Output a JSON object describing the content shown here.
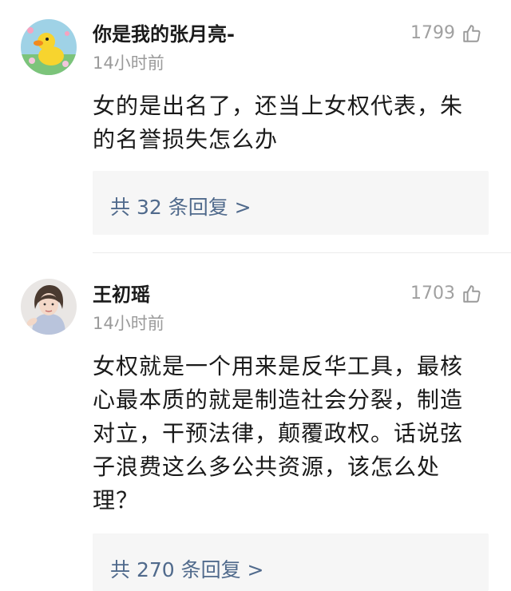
{
  "comments": [
    {
      "username": "你是我的张月亮-",
      "time": "14小时前",
      "likes": "1799",
      "avatar_icon": "duck-avatar",
      "text_lines": [
        "女的是出名了，还当上女权代表，朱",
        "的名誉损失怎么办"
      ],
      "reply_label": "共 32 条回复 >"
    },
    {
      "username": "王初瑶",
      "time": "14小时前",
      "likes": "1703",
      "avatar_icon": "woman-portrait-avatar",
      "text_lines": [
        "女权就是一个用来是反华工具，最核",
        "心最本质的就是制造社会分裂，制造",
        "对立，干预法律，颠覆政权。话说弦",
        "子浪费这么多公共资源，该怎么处",
        "理？"
      ],
      "reply_label": "共 270 条回复 >"
    }
  ],
  "colors": {
    "reply_link": "#506a8c",
    "reply_bg": "#f6f6f6",
    "meta_gray": "#9a9a9a"
  }
}
